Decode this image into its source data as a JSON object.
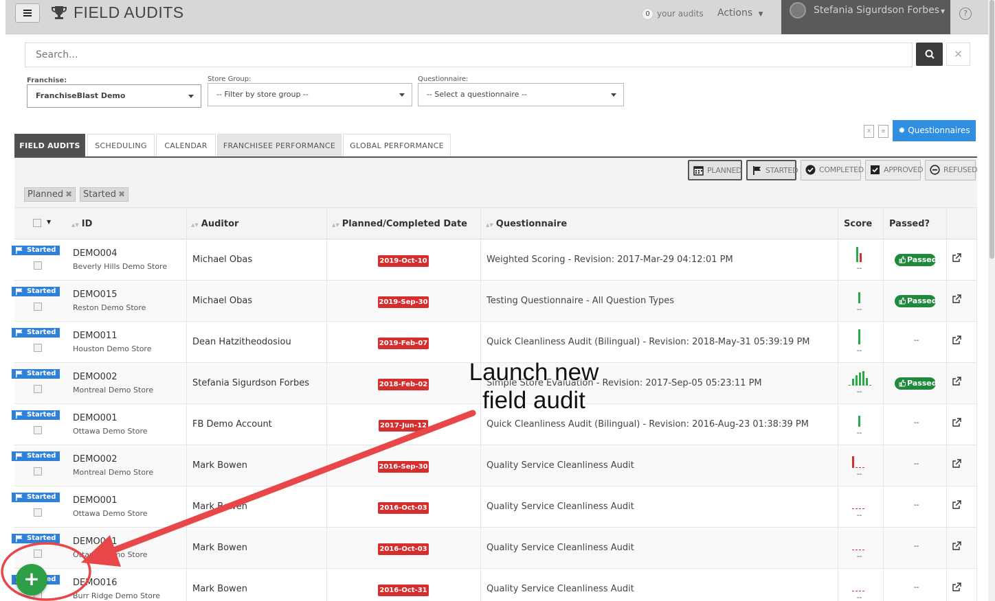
{
  "header": {
    "title": "FIELD AUDITS",
    "audits_count": "0",
    "audits_label": "your audits",
    "actions_label": "Actions",
    "user_name": "Stefania Sigurdson Forbes",
    "help_label": "?"
  },
  "search": {
    "placeholder": "Search..."
  },
  "filters": {
    "franchise_label": "Franchise:",
    "franchise_value": "FranchiseBlast Demo",
    "store_group_label": "Store Group:",
    "store_group_value": "-- Filter by store group --",
    "questionnaire_label": "Questionnaire:",
    "questionnaire_value": "-- Select a questionnaire --"
  },
  "tabs": [
    "FIELD AUDITS",
    "SCHEDULING",
    "CALENDAR",
    "FRANCHISEE PERFORMANCE",
    "GLOBAL PERFORMANCE"
  ],
  "questionnaires_button": "Questionnaires",
  "status_filters": [
    "PLANNED",
    "STARTED",
    "COMPLETED",
    "APPROVED",
    "REFUSED"
  ],
  "active_chips": [
    "Planned",
    "Started"
  ],
  "table": {
    "columns": [
      "ID",
      "Auditor",
      "Planned/Completed Date",
      "Questionnaire",
      "Score",
      "Passed?"
    ],
    "rows": [
      {
        "status": "Started",
        "id": "DEMO004",
        "store": "Beverly Hills Demo Store",
        "auditor": "Michael Obas",
        "date": "2019-Oct-10",
        "questionnaire": "Weighted Scoring - Revision: 2017-Mar-29 04:12:01 PM",
        "score_dash": "--",
        "passed": "Passed"
      },
      {
        "status": "Started",
        "id": "DEMO015",
        "store": "Reston Demo Store",
        "auditor": "Michael Obas",
        "date": "2019-Sep-30",
        "questionnaire": "Testing Questionnaire - All Question Types",
        "score_dash": "--",
        "passed": "Passed"
      },
      {
        "status": "Started",
        "id": "DEMO011",
        "store": "Houston Demo Store",
        "auditor": "Dean Hatzitheodosiou",
        "date": "2019-Feb-07",
        "questionnaire": "Quick Cleanliness Audit (Bilingual) - Revision: 2018-May-31 05:39:19 PM",
        "score_dash": "--",
        "passed": "--"
      },
      {
        "status": "Started",
        "id": "DEMO002",
        "store": "Montreal Demo Store",
        "auditor": "Stefania Sigurdson Forbes",
        "date": "2018-Feb-02",
        "questionnaire": "Simple Store Evaluation - Revision: 2017-Sep-05 05:23:11 PM",
        "score_dash": "--",
        "passed": "Passed"
      },
      {
        "status": "Started",
        "id": "DEMO001",
        "store": "Ottawa Demo Store",
        "auditor": "FB Demo Account",
        "date": "2017-Jun-12",
        "questionnaire": "Quick Cleanliness Audit (Bilingual) - Revision: 2016-Aug-23 01:38:39 PM",
        "score_dash": "--",
        "passed": "--"
      },
      {
        "status": "Started",
        "id": "DEMO002",
        "store": "Montreal Demo Store",
        "auditor": "Mark Bowen",
        "date": "2016-Sep-30",
        "questionnaire": "Quality Service Cleanliness Audit",
        "score_dash": "--",
        "passed": "--"
      },
      {
        "status": "Started",
        "id": "DEMO001",
        "store": "Ottawa Demo Store",
        "auditor": "Mark Bowen",
        "date": "2016-Oct-03",
        "questionnaire": "Quality Service Cleanliness Audit",
        "score_dash": "--",
        "passed": "--"
      },
      {
        "status": "Started",
        "id": "DEMO001",
        "store": "Ottawa Demo Store",
        "auditor": "Mark Bowen",
        "date": "2016-Oct-03",
        "questionnaire": "Quality Service Cleanliness Audit",
        "score_dash": "--",
        "passed": "--"
      },
      {
        "status": "Started",
        "id": "DEMO016",
        "store": "Burr Ridge Demo Store",
        "auditor": "Mark Bowen",
        "date": "2016-Oct-31",
        "questionnaire": "Quality Service Cleanliness Audit",
        "score_dash": "--",
        "passed": "--"
      }
    ]
  },
  "annotation": {
    "line1": "Launch new",
    "line2": "field audit"
  },
  "fab_label": "+",
  "colors": {
    "accent": "#2f8ee0",
    "started": "#2f80d8",
    "date": "#d42e2e",
    "passed": "#1f8a3c",
    "arrow": "#e8474a"
  }
}
